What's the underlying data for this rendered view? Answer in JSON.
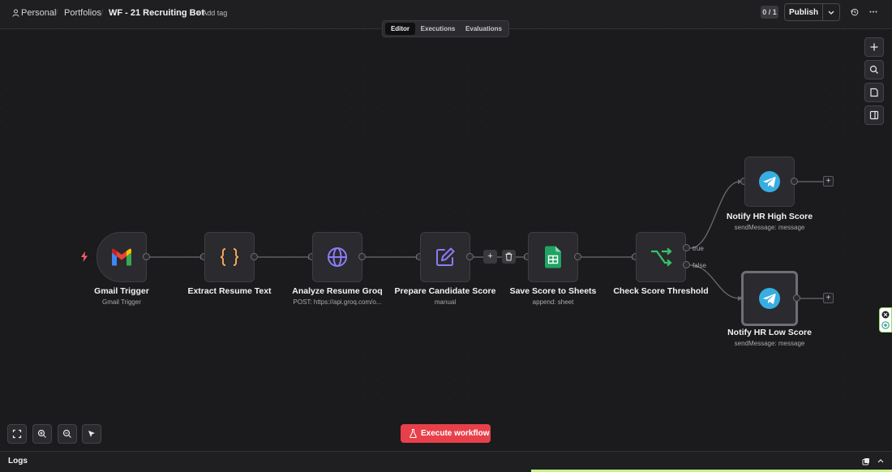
{
  "breadcrumb": {
    "personal": "Personal",
    "folder": "Portfolios",
    "workflow_name": "WF - 21 Recruiting Bot",
    "add_tag": "+ Add tag"
  },
  "header": {
    "counter": "0 / 1",
    "publish_label": "Publish"
  },
  "tabs": [
    {
      "label": "Editor",
      "active": true
    },
    {
      "label": "Executions",
      "active": false
    },
    {
      "label": "Evaluations",
      "active": false
    }
  ],
  "nodes": {
    "gmail": {
      "title": "Gmail Trigger",
      "subtitle": "Gmail Trigger",
      "icon": "gmail-icon"
    },
    "extract": {
      "title": "Extract Resume Text",
      "subtitle": "",
      "icon": "curly-braces-icon"
    },
    "groq": {
      "title": "Analyze Resume Groq",
      "subtitle": "POST: https://api.groq.com/o...",
      "icon": "globe-icon"
    },
    "prepare": {
      "title": "Prepare Candidate Score",
      "subtitle": "manual",
      "icon": "pencil-square-icon"
    },
    "sheets": {
      "title": "Save Score to Sheets",
      "subtitle": "append: sheet",
      "icon": "google-sheets-icon"
    },
    "check": {
      "title": "Check Score Threshold",
      "subtitle": "",
      "icon": "branch-arrows-icon"
    },
    "notify_high": {
      "title": "Notify HR High Score",
      "subtitle": "sendMessage: message",
      "icon": "telegram-icon"
    },
    "notify_low": {
      "title": "Notify HR Low Score",
      "subtitle": "sendMessage: message",
      "icon": "telegram-icon"
    }
  },
  "branches": {
    "true_label": "true",
    "false_label": "false"
  },
  "connection_hover": {
    "add": "+",
    "delete_icon": "trash-icon"
  },
  "add_symbol": "+",
  "execute_label": "Execute workflow",
  "logs_label": "Logs",
  "colors": {
    "canvas": "#1b1a1d",
    "node_bg": "#2b2a2e",
    "execute_button": "#e8404a",
    "telegram": "#37aee2",
    "sheets": "#1fa463",
    "branch": "#35c46a",
    "globe": "#8a7cf8",
    "pencil": "#8a7cf8",
    "braces": "#f5a55b",
    "trigger_bolt": "#ff5d6a"
  }
}
